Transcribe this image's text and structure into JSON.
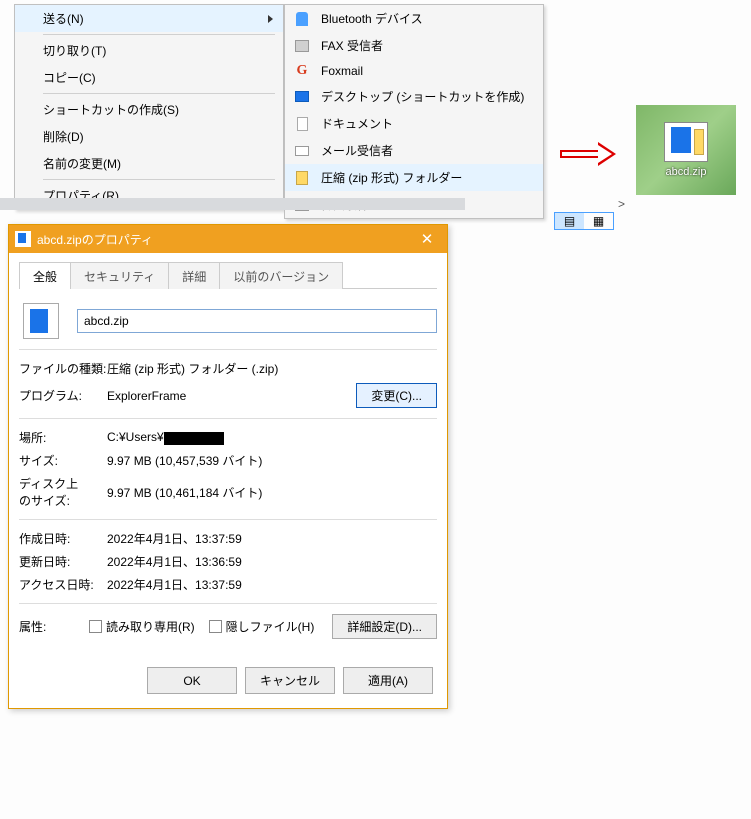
{
  "context_menu_1": {
    "send": "送る(N)",
    "cut": "切り取り(T)",
    "copy": "コピー(C)",
    "shortcut": "ショートカットの作成(S)",
    "delete": "削除(D)",
    "rename": "名前の変更(M)",
    "properties": "プロパティ(R)"
  },
  "context_menu_2": {
    "bluetooth": "Bluetooth デバイス",
    "fax": "FAX 受信者",
    "foxmail": "Foxmail",
    "desktop": "デスクトップ (ショートカットを作成)",
    "documents": "ドキュメント",
    "mail": "メール受信者",
    "zip": "圧縮 (zip 形式) フォルダー",
    "fax_cn": "传真收件人"
  },
  "desktop_icon": {
    "label": "abcd.zip"
  },
  "dialog": {
    "title": "abcd.zipのプロパティ",
    "tabs": {
      "general": "全般",
      "security": "セキュリティ",
      "details": "詳細",
      "prev": "以前のバージョン"
    },
    "filename": "abcd.zip",
    "type_label": "ファイルの種類:",
    "type_value": "圧縮 (zip 形式) フォルダー (.zip)",
    "program_label": "プログラム:",
    "program_value": "ExplorerFrame",
    "change_btn": "変更(C)...",
    "location_label": "場所:",
    "location_value_prefix": "C:¥Users¥",
    "size_label": "サイズ:",
    "size_value": "9.97 MB (10,457,539 バイト)",
    "disk_label": "ディスク上\nのサイズ:",
    "disk_value": "9.97 MB (10,461,184 バイト)",
    "created_label": "作成日時:",
    "created_value": "2022年4月1日、13:37:59",
    "modified_label": "更新日時:",
    "modified_value": "2022年4月1日、13:36:59",
    "accessed_label": "アクセス日時:",
    "accessed_value": "2022年4月1日、13:37:59",
    "attr_label": "属性:",
    "attr_readonly": "読み取り専用(R)",
    "attr_hidden": "隠しファイル(H)",
    "adv_btn": "詳細設定(D)...",
    "ok": "OK",
    "cancel": "キャンセル",
    "apply": "適用(A)"
  }
}
